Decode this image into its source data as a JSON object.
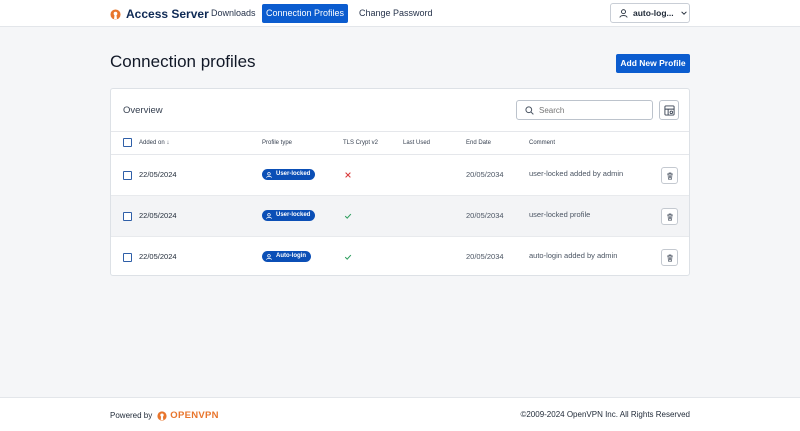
{
  "header": {
    "brand": "Access Server",
    "nav": [
      {
        "label": "Downloads"
      },
      {
        "label": "Connection Profiles",
        "active": true
      },
      {
        "label": "Change Password"
      }
    ],
    "user": "auto-log...",
    "colors": {
      "accent": "#0b5ccf",
      "brand_orange": "#e8752c",
      "navy": "#0f2a55"
    }
  },
  "page": {
    "title": "Connection profiles",
    "add_button": "Add New Profile"
  },
  "card": {
    "title": "Overview",
    "search_placeholder": "Search",
    "columns": [
      "Added on",
      "Profile type",
      "TLS Crypt v2",
      "Last Used",
      "End Date",
      "Comment"
    ],
    "sort_indicator": "↓",
    "rows": [
      {
        "added_on": "22/05/2024",
        "profile_type": "User-locked",
        "tls_crypt_v2": "cross-icon",
        "last_used": "",
        "end_date": "20/05/2034",
        "comment": "user-locked added by admin"
      },
      {
        "added_on": "22/05/2024",
        "profile_type": "User-locked",
        "tls_crypt_v2": "check-icon",
        "last_used": "",
        "end_date": "20/05/2034",
        "comment": "user-locked profile"
      },
      {
        "added_on": "22/05/2024",
        "profile_type": "Auto-login",
        "tls_crypt_v2": "check-icon",
        "last_used": "",
        "end_date": "20/05/2034",
        "comment": "auto-login added by admin"
      }
    ]
  },
  "footer": {
    "powered_by": "Powered by",
    "product": "OPENVPN",
    "copyright": "©2009-2024 OpenVPN Inc. All Rights Reserved"
  }
}
